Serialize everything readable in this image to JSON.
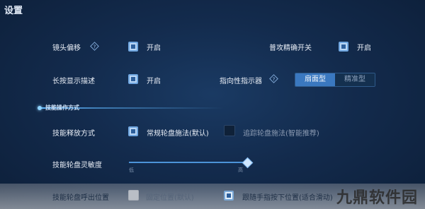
{
  "header": {
    "title": "设置"
  },
  "settings": {
    "camera_offset": {
      "label": "镜头偏移",
      "help_icon": "question-diamond-icon",
      "checked": true,
      "option_label": "开启"
    },
    "normal_attack_precision": {
      "label": "普攻精确开关",
      "checked": true,
      "option_label": "开启"
    },
    "long_press_description": {
      "label": "长按显示描述",
      "checked": true,
      "option_label": "开启"
    },
    "directional_indicator": {
      "label": "指向性指示器",
      "help_icon": "question-diamond-icon",
      "options": [
        "扇面型",
        "精准型"
      ],
      "selected": "扇面型"
    }
  },
  "skill_section": {
    "title": "技能操作方式",
    "release_mode": {
      "label": "技能释放方式",
      "option_1": {
        "label": "常规轮盘施法(默认)",
        "checked": true
      },
      "option_2": {
        "label": "追踪轮盘施法(智能推荐)",
        "checked": false
      }
    },
    "wheel_sensitivity": {
      "label": "技能轮盘灵敏度",
      "low_label": "低",
      "high_label": "高",
      "value_fraction": 0.98
    },
    "wheel_position": {
      "label": "技能轮盘呼出位置",
      "option_1": {
        "label": "固定位置(默认)",
        "checked": false
      },
      "option_2": {
        "label": "跟随手指按下位置(适合滑动)",
        "checked": true
      }
    }
  },
  "watermark": "九鼎软件园",
  "colors": {
    "accent": "#3a78c0",
    "checkbox_on": "#b9d6f5",
    "background": "#132b4d"
  }
}
